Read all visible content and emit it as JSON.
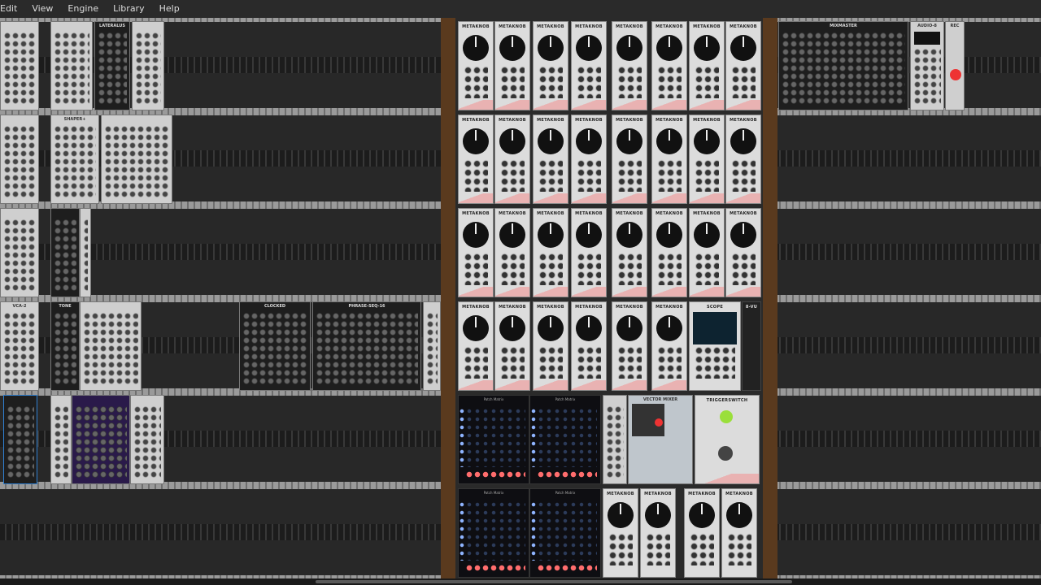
{
  "menu": [
    "Edit",
    "View",
    "Engine",
    "Library",
    "Help"
  ],
  "modules": {
    "metaknob": "METAKNOB",
    "laterally": "LATERALUS",
    "shaper": "SHAPER+",
    "vca": "VCA-2",
    "tone": "TONE",
    "scope": "SCOPE",
    "vu": "8-VU",
    "clocked": "CLOCKED",
    "phrase": "PHRASE-SEQ-16",
    "patch_matrix": "Patch Matrix",
    "vector": "VECTOR MIXER",
    "trigger": "TRIGGERSWITCH",
    "audio": "AUDIO-8",
    "mixer": "MIXMASTER",
    "rec": "REC"
  }
}
